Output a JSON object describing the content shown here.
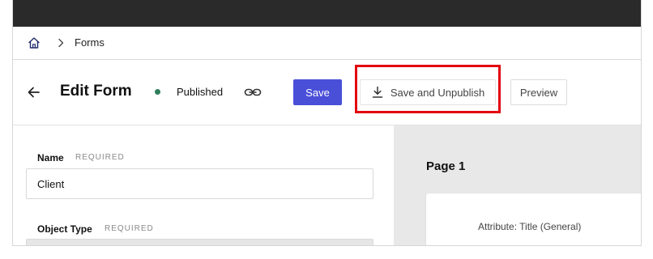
{
  "breadcrumb": {
    "items": [
      "Forms"
    ]
  },
  "header": {
    "title": "Edit Form",
    "status": "Published",
    "buttons": {
      "save": "Save",
      "save_unpublish": "Save and Unpublish",
      "preview": "Preview"
    }
  },
  "form": {
    "name_label": "Name",
    "name_required": "REQUIRED",
    "name_value": "Client",
    "object_type_label": "Object Type",
    "object_type_required": "REQUIRED"
  },
  "preview_panel": {
    "page_title": "Page 1",
    "card_text": "Attribute: Title (General)"
  },
  "colors": {
    "topbar": "#2a2a2a",
    "primary": "#4a4fd8",
    "status_dot": "#2e7d5b",
    "highlight": "#e3000f",
    "preview_bg": "#e8e8e8"
  },
  "icons": {
    "home": "home-icon",
    "chevron": "chevron-right-icon",
    "back": "arrow-left-icon",
    "link": "link-icon",
    "download": "download-icon"
  }
}
